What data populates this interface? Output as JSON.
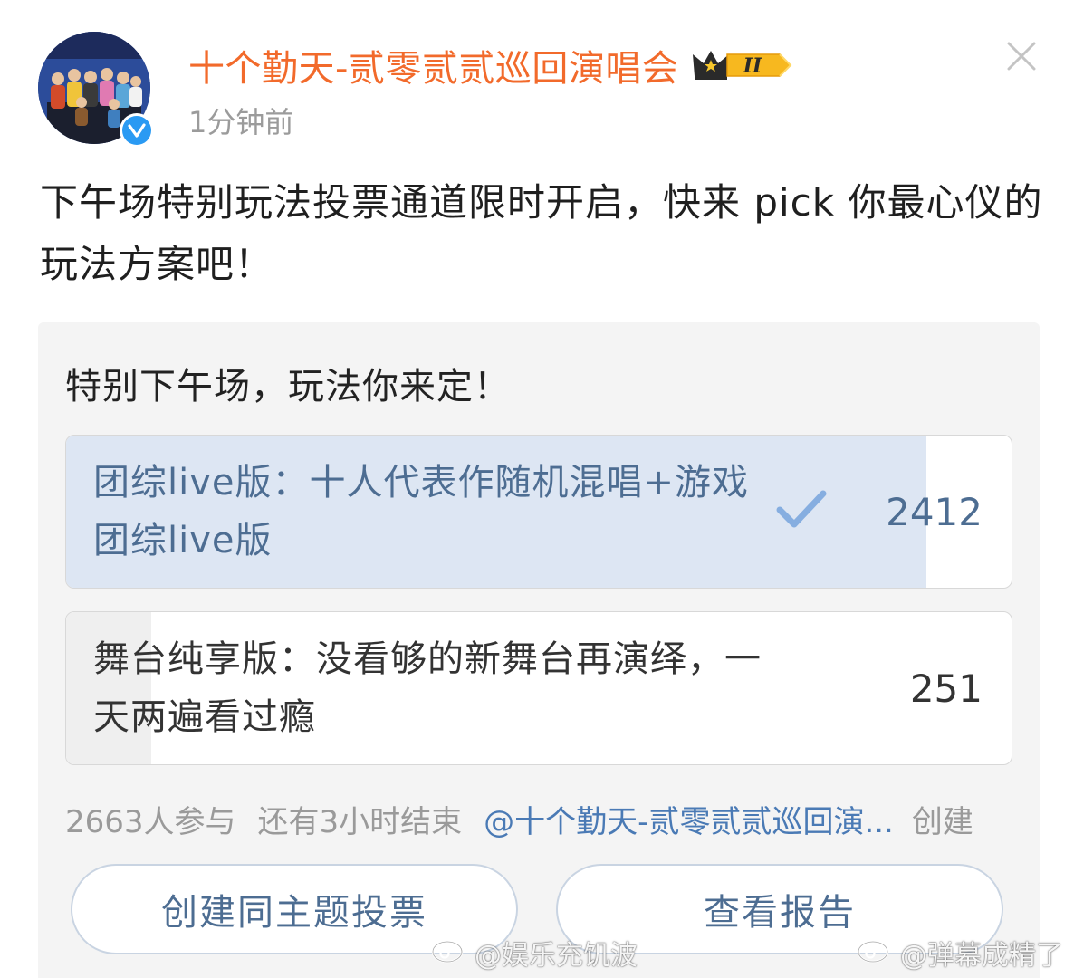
{
  "header": {
    "username": "十个勤天-贰零贰贰巡回演唱会",
    "vip_level": "II",
    "timestamp": "1分钟前"
  },
  "post": {
    "text": "下午场特别玩法投票通道限时开启，快来 pick 你最心仪的玩法方案吧！"
  },
  "poll": {
    "title": "特别下午场，玩法你来定！",
    "options": [
      {
        "label": "团综live版：十人代表作随机混唱+游戏团综live版",
        "count": "2412",
        "fill_fraction": 0.91,
        "selected": true
      },
      {
        "label": "舞台纯享版：没看够的新舞台再演绎，一天两遍看过瘾",
        "count": "251",
        "fill_fraction": 0.09,
        "selected": false
      }
    ],
    "participants": "2663人参与",
    "time_left": "还有3小时结束",
    "creator": "@十个勤天-贰零贰贰巡回演...",
    "created_suffix": "创建",
    "create_button_label": "创建同主题投票",
    "report_button_label": "查看报告"
  },
  "watermarks": [
    "@娱乐充饥波",
    "@弹幕成精了"
  ],
  "colors": {
    "username": "#f26a2b",
    "link": "#4a7ab5",
    "selected_fill": "#dde6f3",
    "unselected_fill": "#efefef",
    "verified": "#2a9af3",
    "vip_badge": "#f7b81f"
  }
}
